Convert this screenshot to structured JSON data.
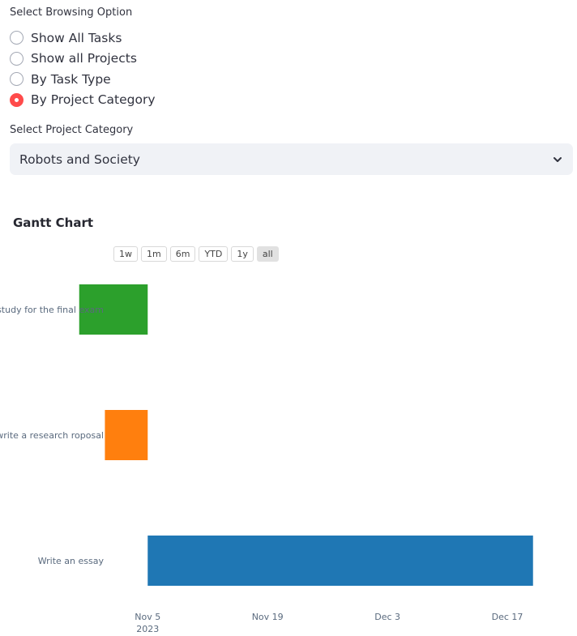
{
  "browsing": {
    "label": "Select Browsing Option",
    "options": [
      {
        "label": "Show All Tasks",
        "checked": false
      },
      {
        "label": "Show all Projects",
        "checked": false
      },
      {
        "label": "By Task Type",
        "checked": false
      },
      {
        "label": "By Project Category",
        "checked": true
      }
    ]
  },
  "category": {
    "label": "Select Project Category",
    "selected": "Robots and Society"
  },
  "chart_title": "Gantt Chart",
  "range_buttons": [
    {
      "label": "1w",
      "active": false
    },
    {
      "label": "1m",
      "active": false
    },
    {
      "label": "6m",
      "active": false
    },
    {
      "label": "YTD",
      "active": false
    },
    {
      "label": "1y",
      "active": false
    },
    {
      "label": "all",
      "active": true
    }
  ],
  "colors": {
    "accent": "#ff4b4b",
    "select_bg": "#f0f2f6"
  },
  "chart_data": {
    "type": "bar",
    "orientation": "horizontal-timeline",
    "title": "",
    "xlabel": "",
    "ylabel": "",
    "x_range": [
      "2023-11-01",
      "2023-12-24"
    ],
    "x_ticks": [
      {
        "date": "2023-11-05",
        "label": "Nov 5",
        "sublabel": "2023"
      },
      {
        "date": "2023-11-19",
        "label": "Nov 19",
        "sublabel": ""
      },
      {
        "date": "2023-12-03",
        "label": "Dec 3",
        "sublabel": ""
      },
      {
        "date": "2023-12-17",
        "label": "Dec 17",
        "sublabel": ""
      }
    ],
    "tasks": [
      {
        "name": "study for the final exam",
        "start": "2023-10-28",
        "end": "2023-11-05",
        "color": "#2ca02c"
      },
      {
        "name": "write a research roposal",
        "start": "2023-10-31",
        "end": "2023-11-05",
        "color": "#ff7f0e"
      },
      {
        "name": "Write an essay",
        "start": "2023-11-05",
        "end": "2023-12-20",
        "color": "#1f77b4"
      }
    ]
  }
}
